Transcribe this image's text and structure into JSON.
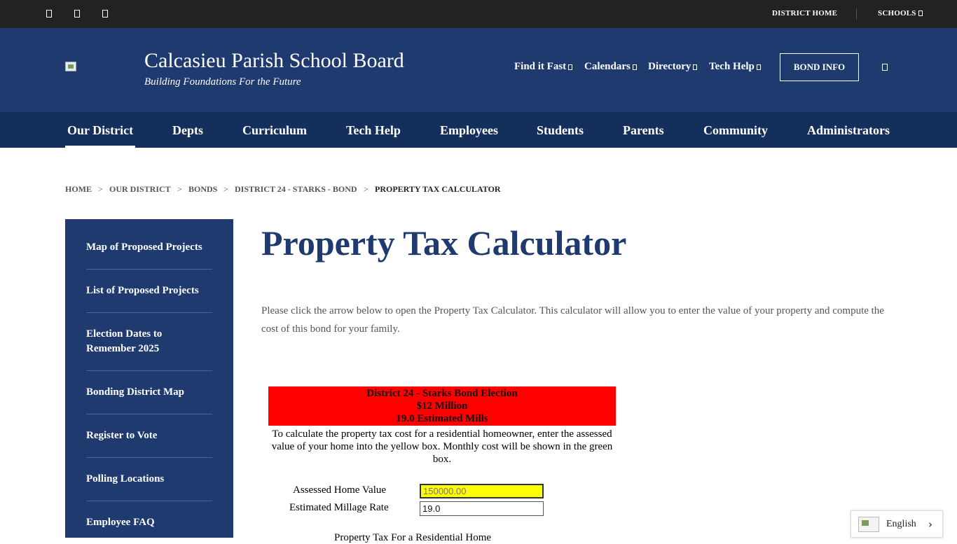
{
  "topbar": {
    "social_icons": [
      "facebook-icon",
      "twitter-icon",
      "instagram-icon"
    ],
    "district_home": "DISTRICT HOME",
    "schools": "SCHOOLS"
  },
  "header": {
    "site_name": "Calcasieu Parish School Board",
    "tagline": "Building Foundations For the Future",
    "nav": [
      "Find it Fast",
      "Calendars",
      "Directory",
      "Tech Help"
    ],
    "bond_button": "BOND INFO"
  },
  "main_nav": {
    "items": [
      "Our District",
      "Depts",
      "Curriculum",
      "Tech Help",
      "Employees",
      "Students",
      "Parents",
      "Community",
      "Administrators"
    ],
    "active": "Our District"
  },
  "breadcrumb": {
    "items": [
      "HOME",
      "OUR DISTRICT",
      "BONDS",
      "DISTRICT 24 - STARKS - BOND",
      "PROPERTY TAX CALCULATOR"
    ],
    "separator": ">"
  },
  "sidebar": {
    "items": [
      "Map of Proposed Projects",
      "List of Proposed Projects",
      "Election Dates to Remember 2025",
      "Bonding District Map",
      "Register to Vote",
      "Polling Locations",
      "Employee FAQ"
    ]
  },
  "main": {
    "title": "Property Tax Calculator",
    "intro": "Please click the arrow below to open the Property Tax Calculator. This calculator will allow you to enter the value of your property and compute the cost of this bond for your family."
  },
  "calculator": {
    "banner_line1": "District 24 - Starks Bond Election",
    "banner_line2": "$12 Million",
    "banner_line3": "19.0 Estimated Mills",
    "instructions": "To calculate the property tax cost for a residential homeowner, enter the assessed value of your home into the yellow box. Monthly cost will be shown in the green box.",
    "assessed_label": "Assessed Home Value",
    "assessed_placeholder": "150000.00",
    "millage_label": "Estimated Millage Rate",
    "millage_value": "19.0",
    "cut_off_text": "Property Tax For a Residential Home",
    "colors": {
      "banner": "#ff0000",
      "input_highlight": "#ffff00"
    }
  },
  "language": {
    "label": "English"
  },
  "colors": {
    "topbar": "#222222",
    "header": "#1e3a6e",
    "main_nav": "#152f5c",
    "title": "#1e3a6e"
  }
}
